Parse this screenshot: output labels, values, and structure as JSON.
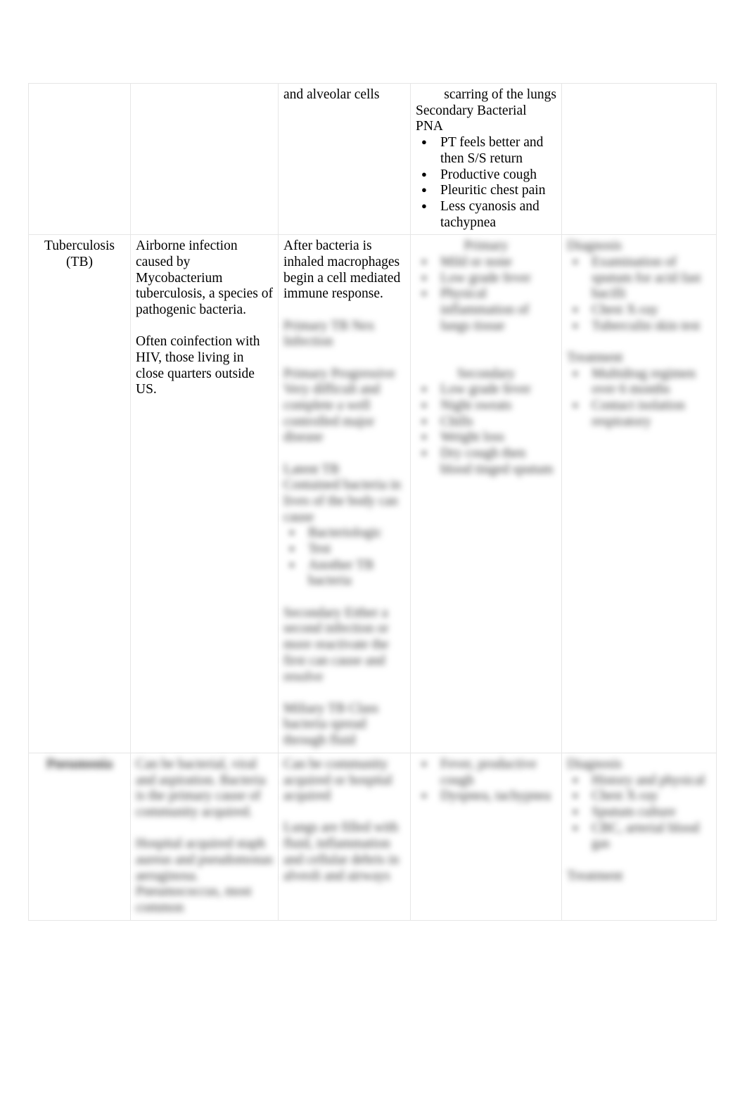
{
  "document": {
    "type": "table",
    "page_background": "#ffffff",
    "border_color": "#e6e6e6",
    "text_color": "#000000",
    "columns": 5,
    "rows": 3
  },
  "table": {
    "row_top": {
      "col1": "",
      "col2": "",
      "col3": "and alveolar cells",
      "col4": {
        "line1": "scarring of the lungs",
        "line2": "Secondary Bacterial PNA",
        "bullets": [
          "PT feels better and then S/S return",
          "Productive cough",
          "Pleuritic chest pain",
          "Less cyanosis and tachypnea"
        ]
      },
      "col5": ""
    },
    "row_tb": {
      "col1_line1": "Tuberculosis",
      "col1_line2": "(TB)",
      "col2_para1": "Airborne infection caused by Mycobacterium tuberculosis, a species of pathogenic bacteria.",
      "col2_para2": "Often coinfection with HIV, those living in close quarters outside US.",
      "col3_para1": "After bacteria is inhaled macrophages begin a cell mediated immune response.",
      "col3_redacted": {
        "note": "illegible blurred text",
        "heading1": "Primary TB Nex Infection",
        "para1": "Primary Progressive Very difficult and complete a well controlled major disease",
        "heading2": "Latent TB",
        "para2": "Contained bacteria in lives of the body can cause",
        "bullets": [
          "Bacteriologic",
          "Test",
          "Another TB bacteria"
        ],
        "para3": "Secondary Either a second infection or more reactivate the first can cause and resolve",
        "heading3": "Miliary TB Class bacteria spread through fluid"
      },
      "col4_redacted": {
        "note": "illegible blurred text",
        "heading1": "Primary",
        "bullets1": [
          "Mild or none",
          "Low grade fever",
          "Physical inflammation of lungs tissue"
        ],
        "heading2": "Secondary",
        "bullets2": [
          "Low grade fever",
          "Night sweats",
          "Chills",
          "Weight loss",
          "Dry cough then blood tinged sputum"
        ]
      },
      "col5_redacted": {
        "note": "illegible blurred text",
        "heading1": "Diagnosis",
        "bullets1": [
          "Examination of sputum for acid fast bacilli",
          "Chest X-ray",
          "Tuberculin skin test"
        ],
        "heading2": "Treatment",
        "bullets2": [
          "Multidrug regimen over 6 months",
          "Contact isolation respiratory"
        ]
      }
    },
    "row_pneumonia": {
      "col1_redacted": "Pneumonia",
      "col2_redacted": {
        "note": "illegible blurred text",
        "para1": "Can be bacterial, viral and aspiration. Bacteria is the primary cause of community acquired.",
        "para2": "Hospital acquired staph aureus and pseudomonas aeruginosa. Pneumococcus, most common"
      },
      "col3_redacted": {
        "note": "illegible blurred text",
        "para1": "Can be community acquired or hospital acquired",
        "para2": "Lungs are filled with fluid, inflammation and cellular debris in alveoli and airways"
      },
      "col4_redacted": {
        "note": "illegible blurred text",
        "bullets": [
          "Fever, productive cough",
          "Dyspnea, tachypnea"
        ]
      },
      "col5_redacted": {
        "note": "illegible blurred text",
        "heading1": "Diagnosis",
        "bullets": [
          "History and physical",
          "Chest X-ray",
          "Sputum culture",
          "CBC, arterial blood gas"
        ],
        "heading2": "Treatment"
      }
    }
  }
}
